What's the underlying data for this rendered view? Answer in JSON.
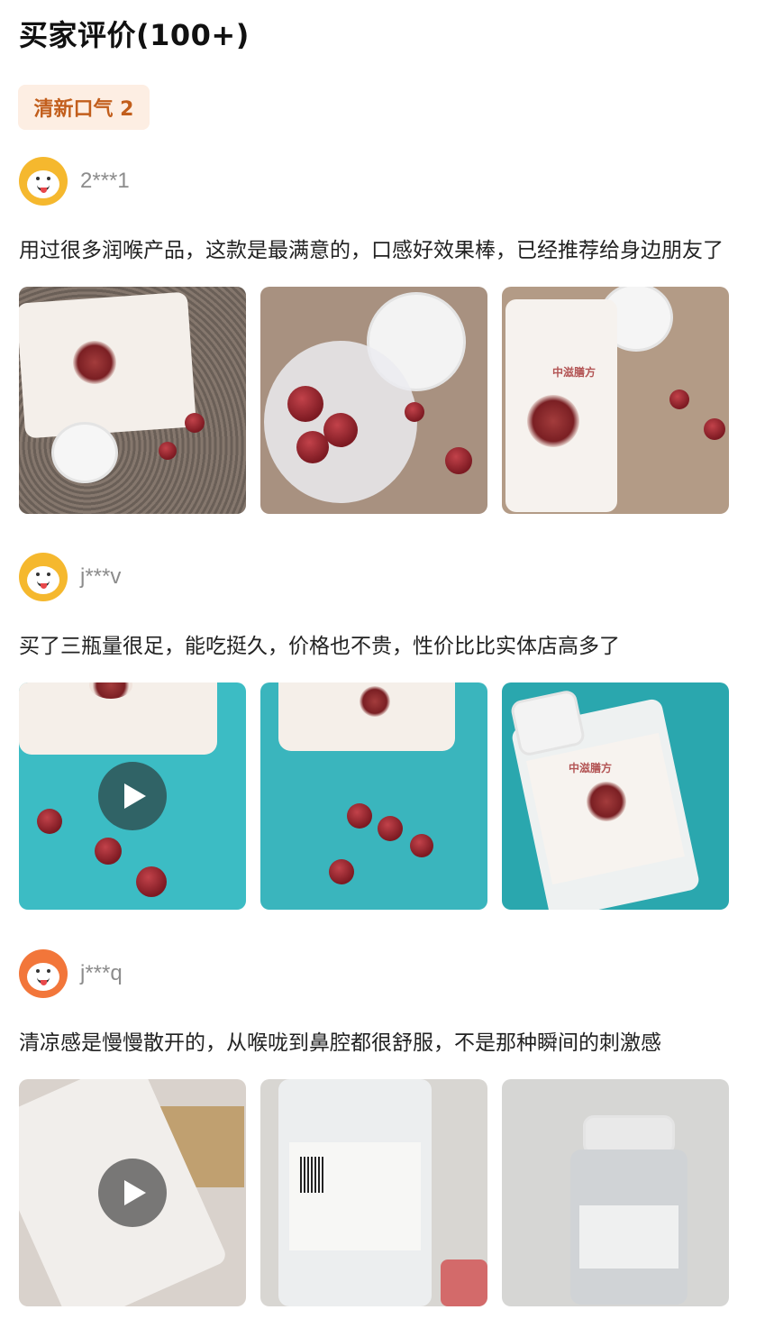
{
  "header": {
    "title": "买家评价(100+)"
  },
  "tag": {
    "label": "清新口气 2"
  },
  "reviews": [
    {
      "username": "2***1",
      "avatar_color": "#f5b82e",
      "text": "用过很多润喉产品，这款是最满意的，口感好效果棒，已经推荐给身边朋友了",
      "photos": [
        {
          "icon": "product-photo",
          "video": false
        },
        {
          "icon": "product-photo",
          "video": false
        },
        {
          "icon": "product-photo",
          "video": false
        }
      ]
    },
    {
      "username": "j***v",
      "avatar_color": "#f5b82e",
      "text": "买了三瓶量很足，能吃挺久，价格也不贵，性价比比实体店高多了",
      "photos": [
        {
          "icon": "product-video",
          "video": true
        },
        {
          "icon": "product-photo",
          "video": false
        },
        {
          "icon": "product-photo",
          "video": false
        }
      ]
    },
    {
      "username": "j***q",
      "avatar_color": "#f2763a",
      "text": "清凉感是慢慢散开的，从喉咙到鼻腔都很舒服，不是那种瞬间的刺激感",
      "photos": [
        {
          "icon": "product-video",
          "video": true
        },
        {
          "icon": "product-photo",
          "video": false
        },
        {
          "icon": "product-photo",
          "video": false
        }
      ]
    }
  ],
  "colors": {
    "tag_bg": "#fdeee3",
    "tag_text": "#c25e1c",
    "username": "#8c8c8c"
  }
}
